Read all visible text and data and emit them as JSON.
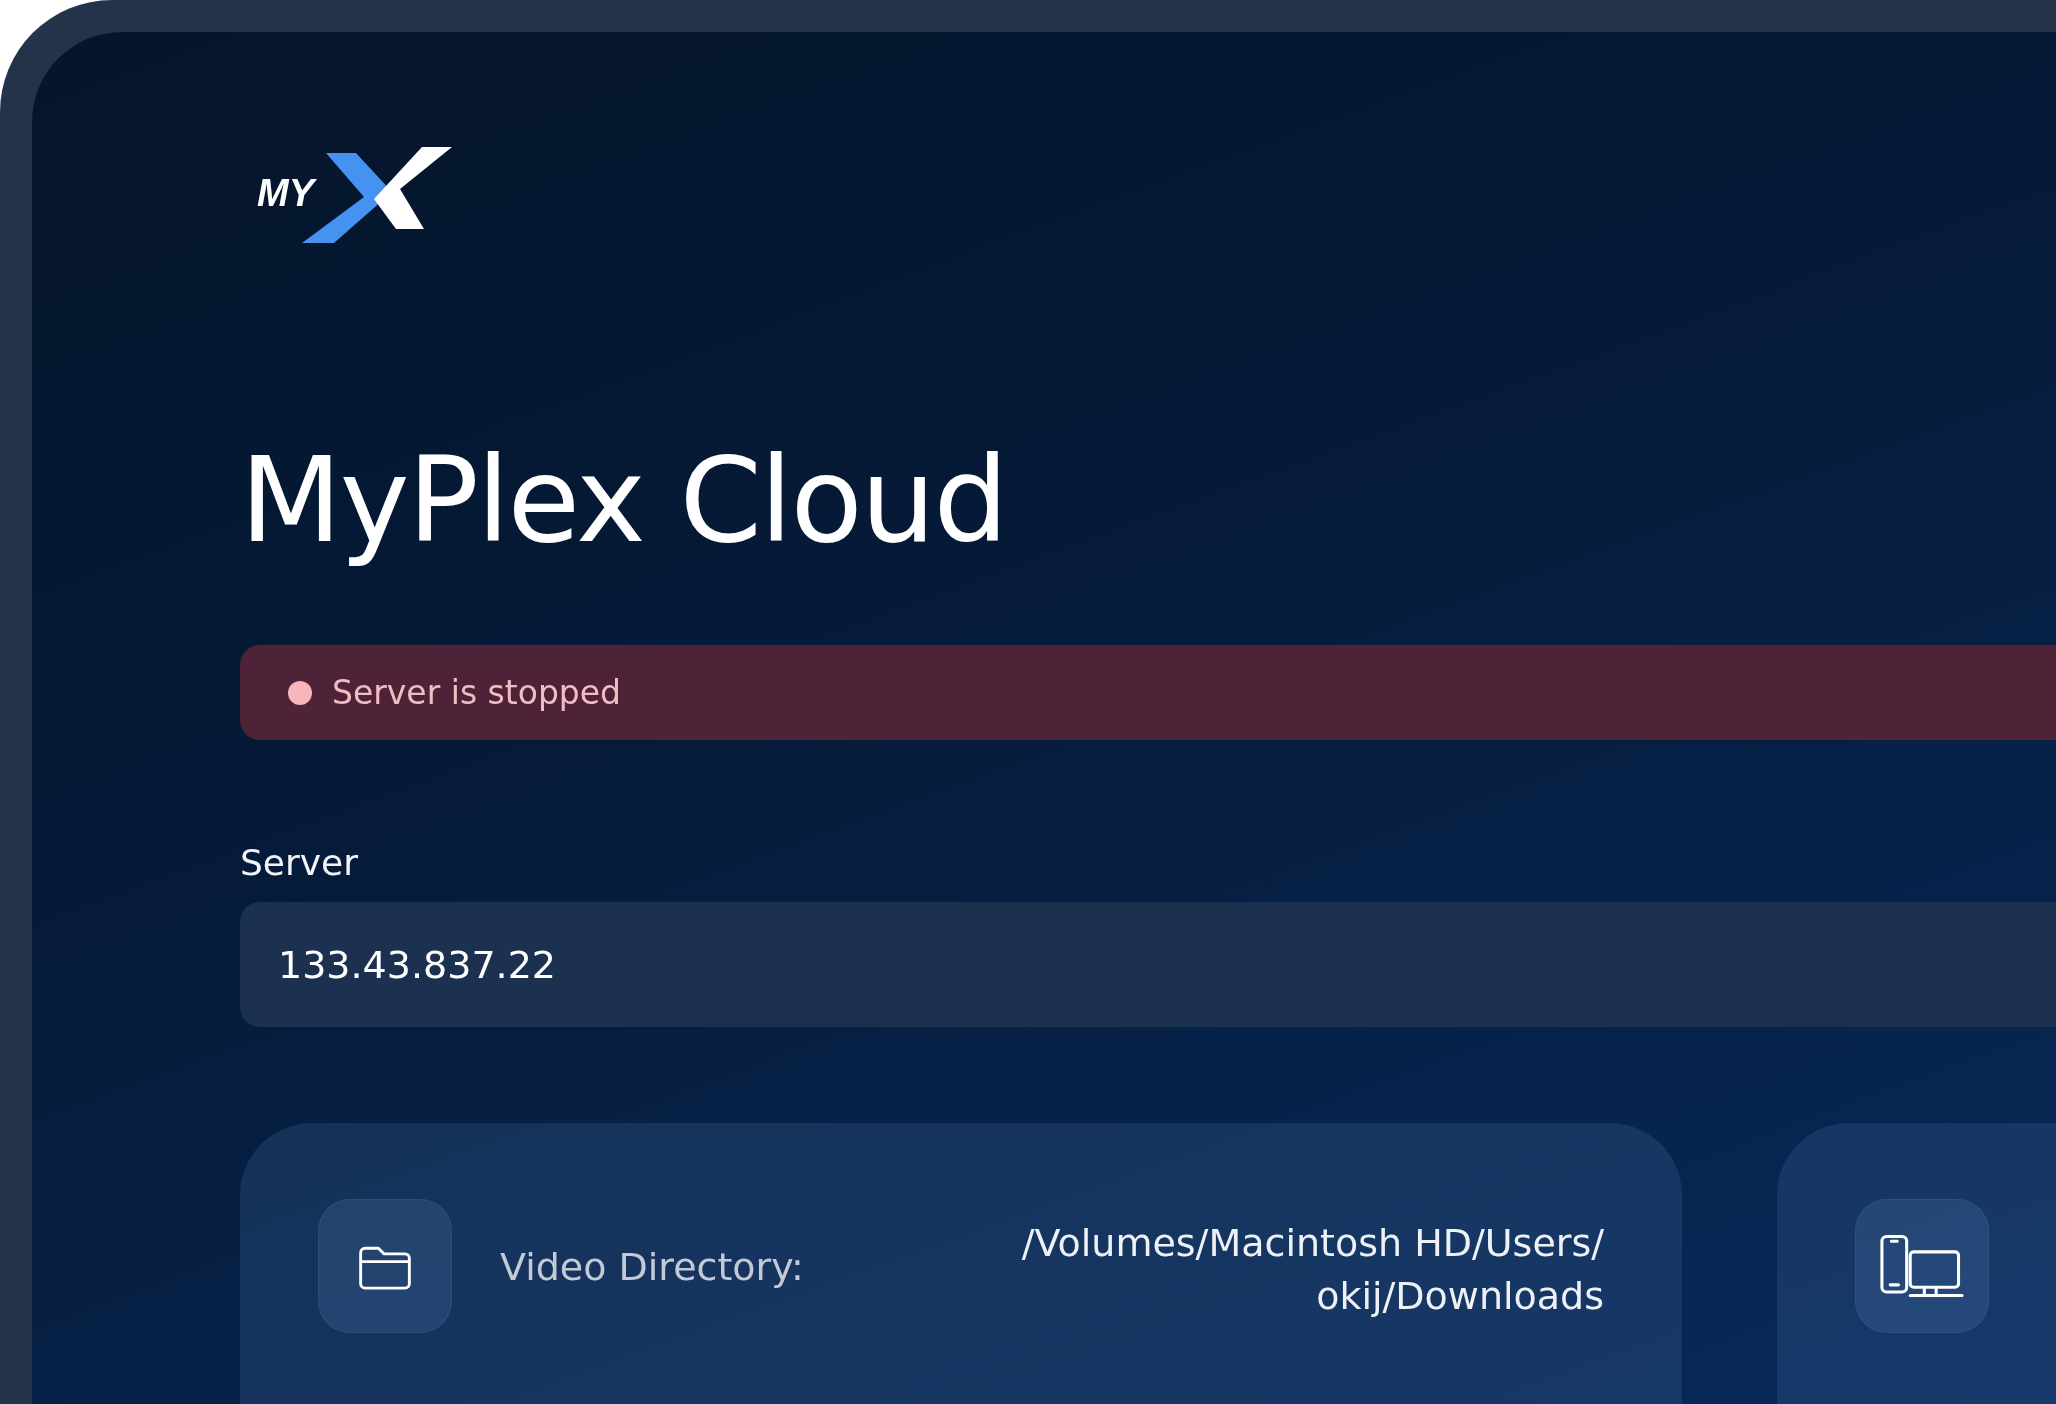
{
  "logo": {
    "text": "MY"
  },
  "title": "MyPlex Cloud",
  "status": {
    "running": false,
    "text": "Server is stopped"
  },
  "server": {
    "label": "Server",
    "value": "133.43.837.22"
  },
  "cards": [
    {
      "kind": "folder",
      "label": "Video Directory:",
      "value_lines": [
        "/Volumes/Macintosh HD/Users/",
        "okij/Downloads"
      ]
    },
    {
      "kind": "devices"
    }
  ]
}
